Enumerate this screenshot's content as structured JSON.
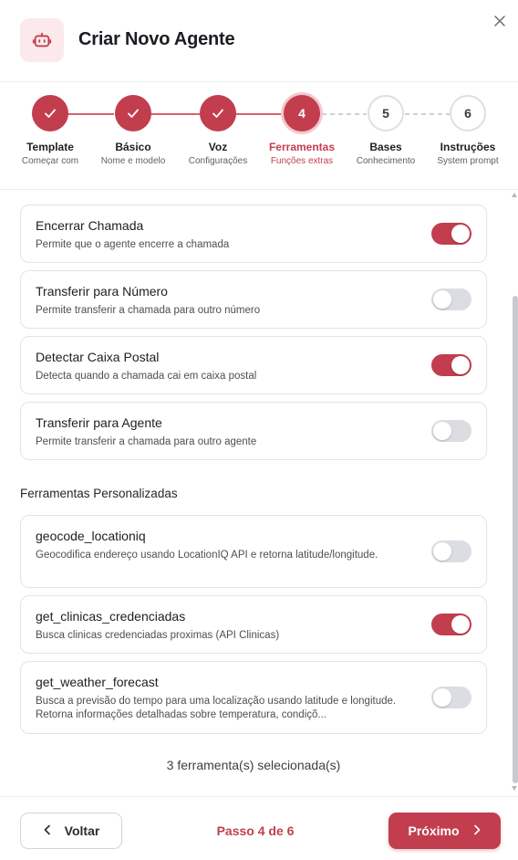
{
  "header": {
    "title": "Criar Novo Agente",
    "icon": "robot-icon",
    "close_icon": "close-icon"
  },
  "stepper": {
    "steps": [
      {
        "number": "1",
        "label": "Template",
        "sub": "Começar com",
        "state": "done"
      },
      {
        "number": "2",
        "label": "Básico",
        "sub": "Nome e modelo",
        "state": "done"
      },
      {
        "number": "3",
        "label": "Voz",
        "sub": "Configurações",
        "state": "done"
      },
      {
        "number": "4",
        "label": "Ferramentas",
        "sub": "Funções extras",
        "state": "active"
      },
      {
        "number": "5",
        "label": "Bases",
        "sub": "Conhecimento",
        "state": "todo"
      },
      {
        "number": "6",
        "label": "Instruções",
        "sub": "System prompt",
        "state": "todo"
      }
    ]
  },
  "tools": [
    {
      "title": "Encerrar Chamada",
      "description": "Permite que o agente encerre a chamada",
      "enabled": true
    },
    {
      "title": "Transferir para Número",
      "description": "Permite transferir a chamada para outro número",
      "enabled": false
    },
    {
      "title": "Detectar Caixa Postal",
      "description": "Detecta quando a chamada cai em caixa postal",
      "enabled": true
    },
    {
      "title": "Transferir para Agente",
      "description": "Permite transferir a chamada para outro agente",
      "enabled": false
    }
  ],
  "custom_section_title": "Ferramentas Personalizadas",
  "custom_tools": [
    {
      "title": "geocode_locationiq",
      "description": "Geocodifica endereço usando LocationIQ API e retorna latitude/longitude.",
      "enabled": false
    },
    {
      "title": "get_clinicas_credenciadas",
      "description": "Busca clinicas credenciadas proximas (API Clinicas)",
      "enabled": true
    },
    {
      "title": "get_weather_forecast",
      "description": "Busca a previsão do tempo para uma localização usando latitude e longitude. Retorna informações detalhadas sobre temperatura, condiçõ...",
      "enabled": false
    }
  ],
  "selected_count": "3 ferramenta(s) selecionada(s)",
  "footer": {
    "back_label": "Voltar",
    "step_indicator": "Passo 4 de 6",
    "next_label": "Próximo"
  },
  "colors": {
    "accent": "#c23e4e",
    "accent_light": "#fbe9eb",
    "toggle_off": "#dcdde2"
  }
}
